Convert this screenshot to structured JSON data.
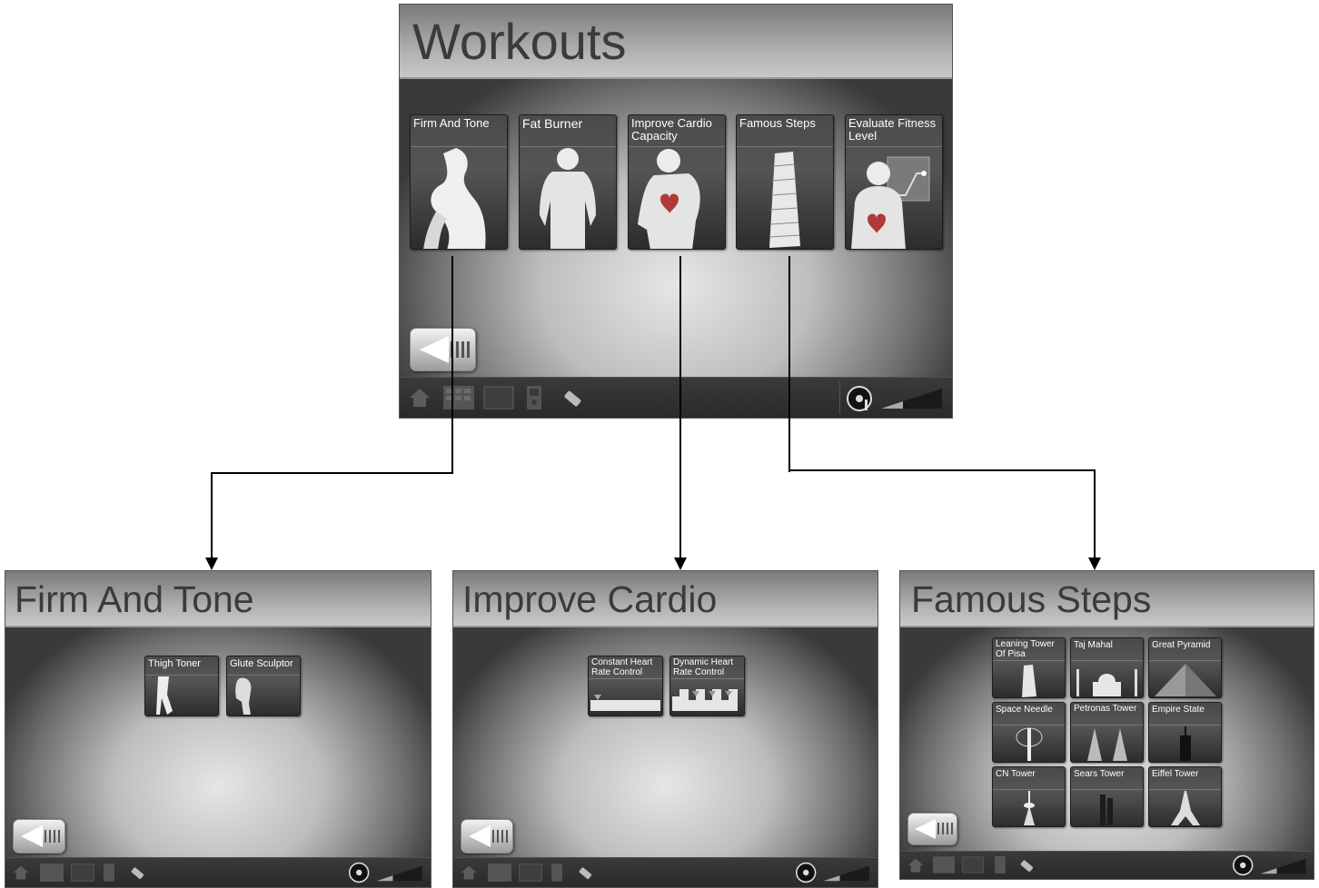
{
  "main": {
    "title": "Workouts",
    "tiles": [
      {
        "label": "Firm And Tone",
        "icon": "woman-silhouette-icon"
      },
      {
        "label": "Fat Burner",
        "icon": "man-silhouette-icon"
      },
      {
        "label": "Improve Cardio Capacity",
        "icon": "runner-heart-icon"
      },
      {
        "label": "Famous Steps",
        "icon": "leaning-tower-icon"
      },
      {
        "label": "Evaluate Fitness Level",
        "icon": "body-heart-graph-icon"
      }
    ]
  },
  "firm_and_tone": {
    "title": "Firm And Tone",
    "tiles": [
      {
        "label": "Thigh Toner",
        "icon": "legs-icon"
      },
      {
        "label": "Glute Sculptor",
        "icon": "glute-figure-icon"
      }
    ]
  },
  "improve_cardio": {
    "title": "Improve Cardio",
    "tiles": [
      {
        "label": "Constant Heart Rate Control",
        "icon": "flat-profile-icon"
      },
      {
        "label": "Dynamic Heart Rate Control",
        "icon": "interval-profile-icon"
      }
    ]
  },
  "famous_steps": {
    "title": "Famous Steps",
    "tiles": [
      {
        "label": "Leaning Tower Of Pisa",
        "icon": "pisa-tower-icon"
      },
      {
        "label": "Taj Mahal",
        "icon": "taj-mahal-icon"
      },
      {
        "label": "Great Pyramid",
        "icon": "pyramid-icon"
      },
      {
        "label": "Space Needle",
        "icon": "space-needle-icon"
      },
      {
        "label": "Petronas Tower",
        "icon": "petronas-tower-icon"
      },
      {
        "label": "Empire State",
        "icon": "empire-state-icon"
      },
      {
        "label": "CN Tower",
        "icon": "cn-tower-icon"
      },
      {
        "label": "Sears Tower",
        "icon": "sears-tower-icon"
      },
      {
        "label": "Eiffel Tower",
        "icon": "eiffel-tower-icon"
      }
    ]
  },
  "taskbar_icons": [
    "home-icon",
    "keypad-icon",
    "display-icon",
    "media-player-icon",
    "usb-key-icon",
    "audio-icon",
    "volume-level-icon"
  ],
  "colors": {
    "title_text": "#3b3b3b",
    "tile_text": "#ffffff",
    "taskbar": "#2e2e2e",
    "connector": "#000000"
  }
}
